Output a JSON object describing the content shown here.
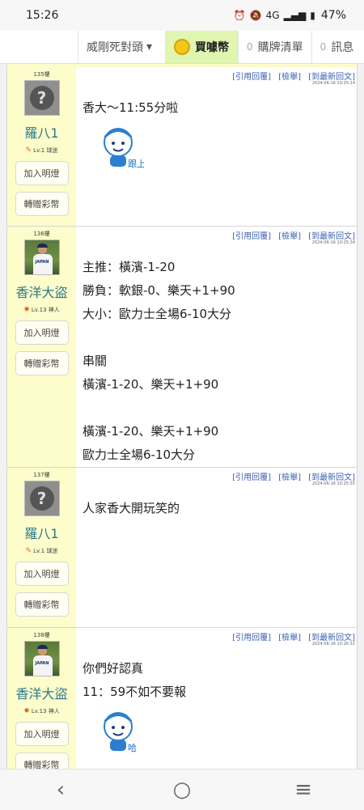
{
  "status": {
    "time": "15:26",
    "network": "4G",
    "battery": "47%"
  },
  "nav": {
    "menu_label": "威剛死對頭",
    "buy_label": "買噱幣",
    "cart_count": "0",
    "cart_label": "購牌清單",
    "msg_count": "0",
    "msg_label": "訊息"
  },
  "actions": {
    "quote": "[引用回覆]",
    "report": "[檢舉]",
    "latest": "[到最新回文]"
  },
  "posts": [
    {
      "floor": "135樓",
      "user": "羅八1",
      "level": "Lv.1 球迷",
      "ts": "2024-06-16 10:25:14",
      "lines": [
        "香大〜11:55分啦"
      ],
      "sticker": "跟上",
      "btn_add": "加入明燈",
      "btn_gift": "轉贈彩幣"
    },
    {
      "floor": "136樓",
      "user": "香洋大盜",
      "level": "Lv.13 神人",
      "ts": "2024-06-16 10:25:34",
      "lines": [
        "主推：橫濱-1-20",
        "勝負：軟銀-0、樂天+1+90",
        "大小：歐力士全場6-10大分",
        "",
        "串關",
        "橫濱-1-20、樂天+1+90",
        "",
        "橫濱-1-20、樂天+1+90",
        "歐力士全場6-10大分"
      ],
      "btn_add": "加入明燈",
      "btn_gift": "轉贈彩幣"
    },
    {
      "floor": "137樓",
      "user": "羅八1",
      "level": "Lv.1 球迷",
      "ts": "2024-06-16 10:25:55",
      "lines": [
        "人家香大開玩笑的"
      ],
      "btn_add": "加入明燈",
      "btn_gift": "轉贈彩幣"
    },
    {
      "floor": "138樓",
      "user": "香洋大盜",
      "level": "Lv.13 神人",
      "ts": "2024-06-16 10:26:31",
      "lines": [
        "你們好認真",
        "11：59不如不要報"
      ],
      "sticker": "哈",
      "btn_add": "加入明燈",
      "btn_gift": "轉贈彩幣"
    }
  ]
}
